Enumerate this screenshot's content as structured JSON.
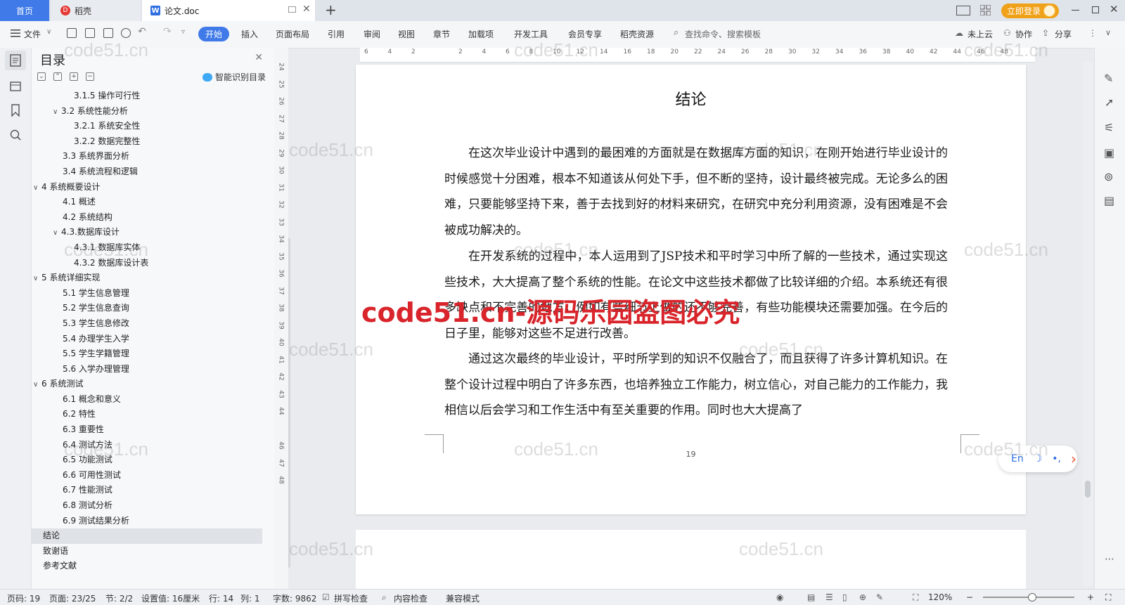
{
  "tabs": {
    "home": "首页",
    "daoke": "稻壳",
    "doc": "论文.doc",
    "doc_icon": "W",
    "daoke_icon": "D",
    "add": "+"
  },
  "titlebar": {
    "login": "立即登录"
  },
  "ribbon": {
    "file": "文件",
    "start": "开始",
    "items": [
      "插入",
      "页面布局",
      "引用",
      "审阅",
      "视图",
      "章节",
      "加载项",
      "开发工具",
      "会员专享",
      "稻壳资源"
    ],
    "search_placeholder": "查找命令、搜索模板",
    "cloud": "未上云",
    "collab": "协作",
    "share": "分享"
  },
  "outline": {
    "title": "目录",
    "smart": "智能识别目录",
    "tools": [
      "⌄",
      "⌃",
      "+",
      "−"
    ],
    "items": [
      {
        "label": "3.1.5 操作可行性",
        "level": 3,
        "caret": ""
      },
      {
        "label": "3.2 系统性能分析",
        "level": 2,
        "caret": "∨"
      },
      {
        "label": "3.2.1  系统安全性",
        "level": 3,
        "caret": ""
      },
      {
        "label": "3.2.2  数据完整性",
        "level": 3,
        "caret": ""
      },
      {
        "label": "3.3 系统界面分析",
        "level": 2,
        "caret": ""
      },
      {
        "label": "3.4 系统流程和逻辑",
        "level": 2,
        "caret": ""
      },
      {
        "label": "4 系统概要设计",
        "level": 1,
        "caret": "∨"
      },
      {
        "label": "4.1 概述",
        "level": 2,
        "caret": ""
      },
      {
        "label": "4.2 系统结构",
        "level": 2,
        "caret": ""
      },
      {
        "label": "4.3.数据库设计",
        "level": 2,
        "caret": "∨"
      },
      {
        "label": "4.3.1 数据库实体",
        "level": 3,
        "caret": ""
      },
      {
        "label": "4.3.2 数据库设计表",
        "level": 3,
        "caret": ""
      },
      {
        "label": "5 系统详细实现",
        "level": 1,
        "caret": "∨"
      },
      {
        "label": "5.1  学生信息管理",
        "level": 2,
        "caret": ""
      },
      {
        "label": "5.2  学生信息查询",
        "level": 2,
        "caret": ""
      },
      {
        "label": "5.3  学生信息修改",
        "level": 2,
        "caret": ""
      },
      {
        "label": "5.4  办理学生入学",
        "level": 2,
        "caret": ""
      },
      {
        "label": "5.5  学生学籍管理",
        "level": 2,
        "caret": ""
      },
      {
        "label": "5.6  入学办理管理",
        "level": 2,
        "caret": ""
      },
      {
        "label": "6 系统测试",
        "level": 1,
        "caret": "∨"
      },
      {
        "label": "6.1 概念和意义",
        "level": 2,
        "caret": ""
      },
      {
        "label": "6.2 特性",
        "level": 2,
        "caret": ""
      },
      {
        "label": "6.3 重要性",
        "level": 2,
        "caret": ""
      },
      {
        "label": "6.4 测试方法",
        "level": 2,
        "caret": ""
      },
      {
        "label": "6.5  功能测试",
        "level": 2,
        "caret": ""
      },
      {
        "label": "6.6 可用性测试",
        "level": 2,
        "caret": ""
      },
      {
        "label": "6.7 性能测试",
        "level": 2,
        "caret": ""
      },
      {
        "label": "6.8 测试分析",
        "level": 2,
        "caret": ""
      },
      {
        "label": "6.9 测试结果分析",
        "level": 2,
        "caret": ""
      },
      {
        "label": "结论",
        "level": 1,
        "caret": "",
        "selected": true
      },
      {
        "label": "致谢语",
        "level": 1,
        "caret": ""
      },
      {
        "label": "参考文献",
        "level": 1,
        "caret": ""
      }
    ]
  },
  "ruler": {
    "h": [
      "6",
      "4",
      "2",
      "",
      "2",
      "4",
      "6",
      "8",
      "10",
      "12",
      "14",
      "16",
      "18",
      "20",
      "22",
      "24",
      "26",
      "28",
      "30",
      "32",
      "34",
      "36",
      "38",
      "40",
      "42",
      "44",
      "46",
      "48"
    ],
    "v": [
      "24",
      "25",
      "26",
      "27",
      "28",
      "29",
      "30",
      "31",
      "32",
      "33",
      "34",
      "35",
      "36",
      "37",
      "38",
      "39",
      "40",
      "41",
      "42",
      "43",
      "44",
      "",
      "46",
      "47",
      "48"
    ]
  },
  "document": {
    "heading": "结论",
    "paragraphs": [
      "在这次毕业设计中遇到的最困难的方面就是在数据库方面的知识，在刚开始进行毕业设计的时候感觉十分困难，根本不知道该从何处下手，但不断的坚持，设计最终被完成。无论多么的困难，只要能够坚持下来，善于去找到好的材料来研究，在研究中充分利用资源，没有困难是不会被成功解决的。",
      "在开发系统的过程中，本人运用到了JSP技术和平时学习中所了解的一些技术，通过实现这些技术，大大提高了整个系统的性能。在论文中这些技术都做了比较详细的介绍。本系统还有很多缺点和不完善的地方，例如有些细节上做的还不够完善，有些功能模块还需要加强。在今后的日子里，能够对这些不足进行改善。",
      "通过这次最终的毕业设计，平时所学到的知识不仅融合了，而且获得了许多计算机知识。在整个设计过程中明白了许多东西，也培养独立工作能力，树立信心，对自己能力的工作能力，我相信以后会学习和工作生活中有至关重要的作用。同时也大大提高了"
    ],
    "page_number": "19"
  },
  "ime": {
    "lang": "En",
    "moon": "☽",
    "dots": "•,",
    "arrow": "›"
  },
  "watermark": {
    "text": "code51.cn",
    "red": "code51.cn-源码乐园盗图必究"
  },
  "statusbar": {
    "page": "页码: 19",
    "pages": "页面: 23/25",
    "section": "节: 2/2",
    "setting": "设置值: 16厘米",
    "row": "行: 14",
    "col": "列: 1",
    "words": "字数: 9862",
    "spell": "拼写检查",
    "content": "内容检查",
    "compat": "兼容模式",
    "zoom": "120%"
  },
  "colors": {
    "accent": "#3f7ae8",
    "login": "#f0a11a",
    "watermark_red": "#d8242a"
  }
}
